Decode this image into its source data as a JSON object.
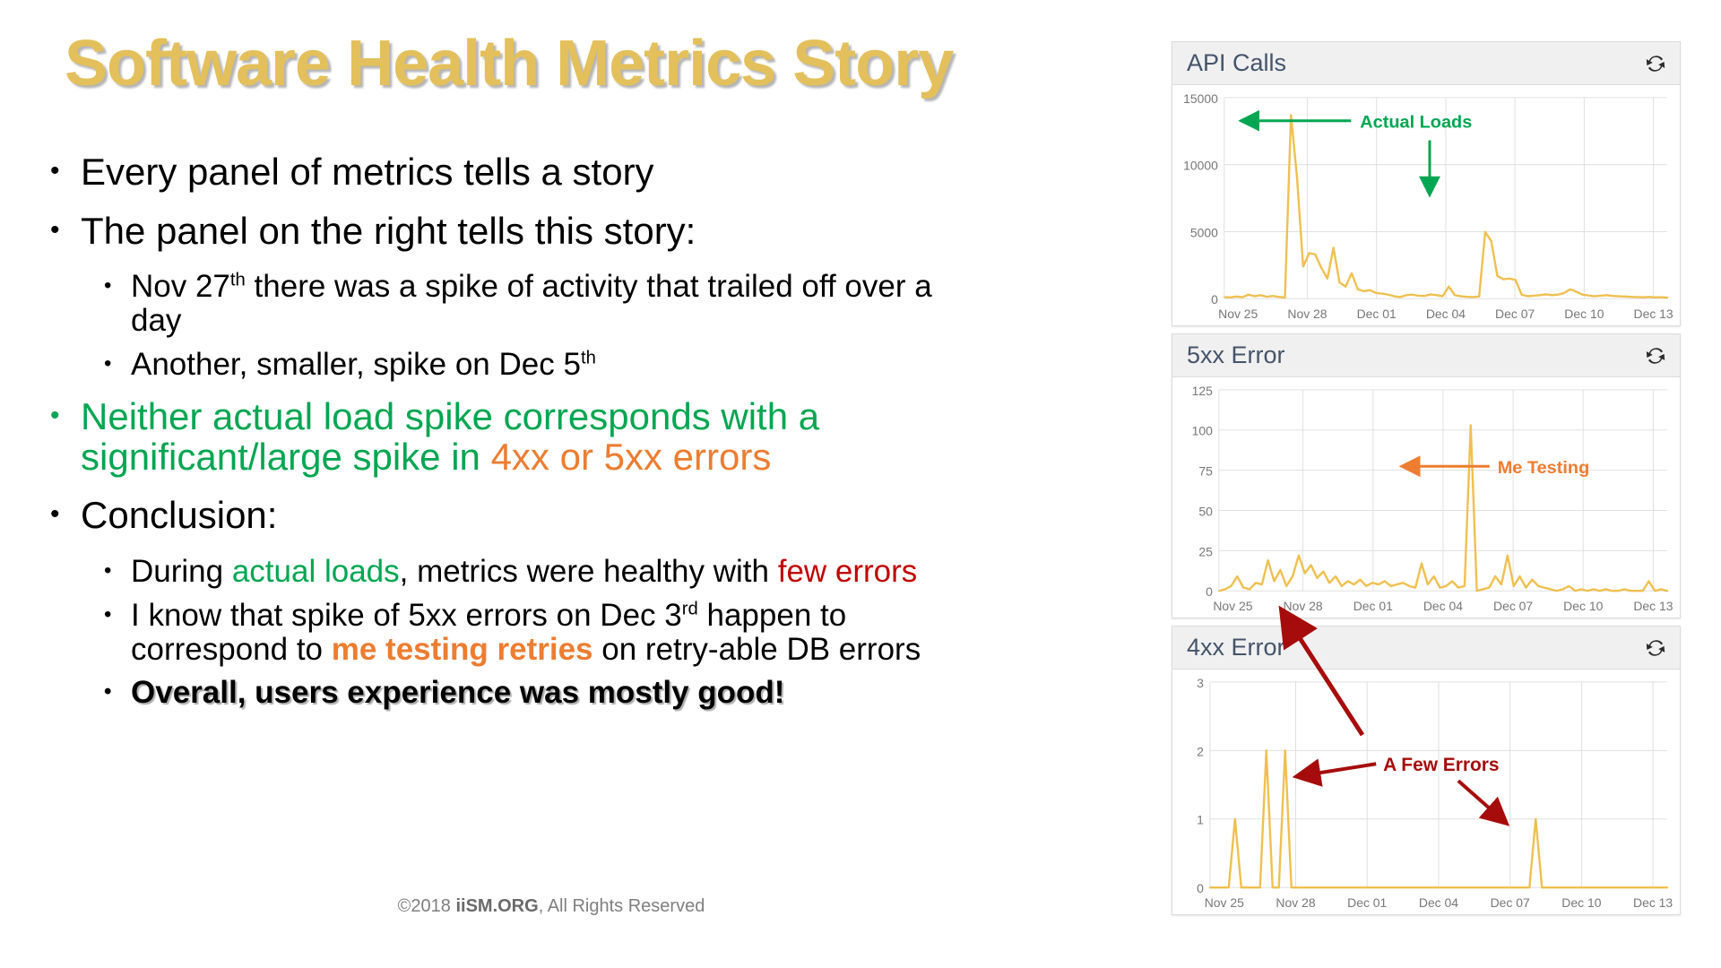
{
  "slide": {
    "title": "Software Health Metrics Story",
    "footer_prefix": "©2018 ",
    "footer_brand": "iiSM.ORG",
    "footer_suffix": ", All Rights Reserved"
  },
  "bullets": {
    "b1": "Every panel of metrics tells a story",
    "b2": "The panel on the right tells this story:",
    "b2a_pre": "Nov 27",
    "b2a_sup": "th",
    "b2a_post": " there was a spike of activity that trailed off over a day",
    "b2b_pre": "Another, smaller, spike on Dec 5",
    "b2b_sup": "th",
    "b3_green_1": "Neither actual load spike corresponds with a significant/large spike in ",
    "b3_orange": "4xx or 5xx errors",
    "b4": "Conclusion:",
    "b4a_pre": "During ",
    "b4a_green": "actual loads",
    "b4a_mid": ", metrics were healthy with ",
    "b4a_red": "few errors",
    "b4b_pre": "I know that spike of 5xx errors on Dec 3",
    "b4b_sup": "rd",
    "b4b_mid": " happen to correspond to ",
    "b4b_orange": "me testing retries",
    "b4b_post": " on retry-able DB errors",
    "b4c": "Overall, users experience was mostly good!"
  },
  "bullet_glyph": "•",
  "colors": {
    "title_gold": "#E3C05B",
    "green": "#00A651",
    "orange": "#ED7D31",
    "red": "#C00000",
    "dark_red_arrow": "#A60C0C",
    "chart_line": "#EFC050",
    "panel_header_bg": "#F0F0F0",
    "panel_title": "#44546A",
    "grid": "#E0E0E0",
    "tick_label": "#777777"
  },
  "dashboard": {
    "panels": [
      {
        "title": "API Calls",
        "refresh_icon": "refresh-icon"
      },
      {
        "title": "5xx Error",
        "refresh_icon": "refresh-icon"
      },
      {
        "title": "4xx Error",
        "refresh_icon": "refresh-icon"
      }
    ]
  },
  "annotations": {
    "actual_loads": "Actual Loads",
    "me_testing": "Me Testing",
    "a_few_errors": "A Few Errors"
  },
  "chart_data": [
    {
      "type": "line",
      "title": "API Calls",
      "xlabel": "",
      "ylabel": "",
      "ylim": [
        0,
        15000
      ],
      "yticks": [
        0,
        5000,
        10000,
        15000
      ],
      "xticks": [
        "Nov 25",
        "Nov 28",
        "Dec 01",
        "Dec 04",
        "Dec 07",
        "Dec 10",
        "Dec 13"
      ],
      "x_start": "Nov 25",
      "x_end": "Dec 14",
      "grid": true,
      "legend": "none",
      "line_color": "#EFC050",
      "annotations": [
        {
          "text": "Actual Loads",
          "color": "#00A651",
          "points_to": "Nov 27 spike (~13700) and Dec 04 spike (~5000)"
        }
      ],
      "values": [
        120,
        90,
        160,
        110,
        300,
        180,
        260,
        140,
        200,
        130,
        90,
        13700,
        9000,
        2400,
        3400,
        3300,
        2300,
        1500,
        3800,
        1200,
        900,
        1900,
        700,
        560,
        640,
        420,
        380,
        300,
        180,
        120,
        260,
        300,
        220,
        200,
        320,
        260,
        180,
        900,
        260,
        180,
        140,
        120,
        160,
        4980,
        4300,
        1700,
        1450,
        1500,
        1400,
        300,
        180,
        220,
        260,
        320,
        260,
        300,
        420,
        700,
        520,
        300,
        240,
        180,
        220,
        260,
        200,
        180,
        160,
        140,
        120,
        100,
        130,
        90,
        110,
        80
      ]
    },
    {
      "type": "line",
      "title": "5xx Error",
      "xlabel": "",
      "ylabel": "",
      "ylim": [
        0,
        125
      ],
      "yticks": [
        0,
        25,
        50,
        75,
        100,
        125
      ],
      "xticks": [
        "Nov 25",
        "Nov 28",
        "Dec 01",
        "Dec 04",
        "Dec 07",
        "Dec 10",
        "Dec 13"
      ],
      "x_start": "Nov 25",
      "x_end": "Dec 14",
      "grid": true,
      "legend": "none",
      "line_color": "#EFC050",
      "annotations": [
        {
          "text": "Me Testing",
          "color": "#ED7D31",
          "points_to": "Dec 03 spike (~103)"
        }
      ],
      "values": [
        0,
        1,
        3,
        9,
        2,
        1,
        5,
        4,
        19,
        6,
        13,
        3,
        9,
        22,
        11,
        16,
        8,
        12,
        5,
        9,
        3,
        6,
        4,
        7,
        3,
        5,
        4,
        6,
        3,
        4,
        5,
        3,
        2,
        17,
        4,
        9,
        2,
        3,
        6,
        2,
        3,
        103,
        0,
        1,
        2,
        9,
        4,
        22,
        3,
        9,
        2,
        7,
        3,
        2,
        1,
        0,
        1,
        3,
        0,
        1,
        0,
        1,
        0,
        1,
        0,
        0,
        1,
        0,
        0,
        0,
        6,
        0,
        1,
        0
      ]
    },
    {
      "type": "line",
      "title": "4xx Error",
      "xlabel": "",
      "ylabel": "",
      "ylim": [
        0,
        3
      ],
      "yticks": [
        0,
        1,
        2,
        3
      ],
      "xticks": [
        "Nov 25",
        "Nov 28",
        "Dec 01",
        "Dec 04",
        "Dec 07",
        "Dec 10",
        "Dec 13"
      ],
      "x_start": "Nov 25",
      "x_end": "Dec 14",
      "grid": true,
      "legend": "none",
      "line_color": "#EFC050",
      "annotations": [
        {
          "text": "A Few Errors",
          "color": "#A60C0C",
          "points_to": "Nov 27-28 spikes (value 2) and Dec 08 spike (value 1)"
        }
      ],
      "values": [
        0,
        0,
        0,
        0,
        1,
        0,
        0,
        0,
        0,
        2,
        0,
        0,
        2,
        0,
        0,
        0,
        0,
        0,
        0,
        0,
        0,
        0,
        0,
        0,
        0,
        0,
        0,
        0,
        0,
        0,
        0,
        0,
        0,
        0,
        0,
        0,
        0,
        0,
        0,
        0,
        0,
        0,
        0,
        0,
        0,
        0,
        0,
        0,
        0,
        0,
        0,
        0,
        1,
        0,
        0,
        0,
        0,
        0,
        0,
        0,
        0,
        0,
        0,
        0,
        0,
        0,
        0,
        0,
        0,
        0,
        0,
        0,
        0,
        0
      ]
    }
  ]
}
